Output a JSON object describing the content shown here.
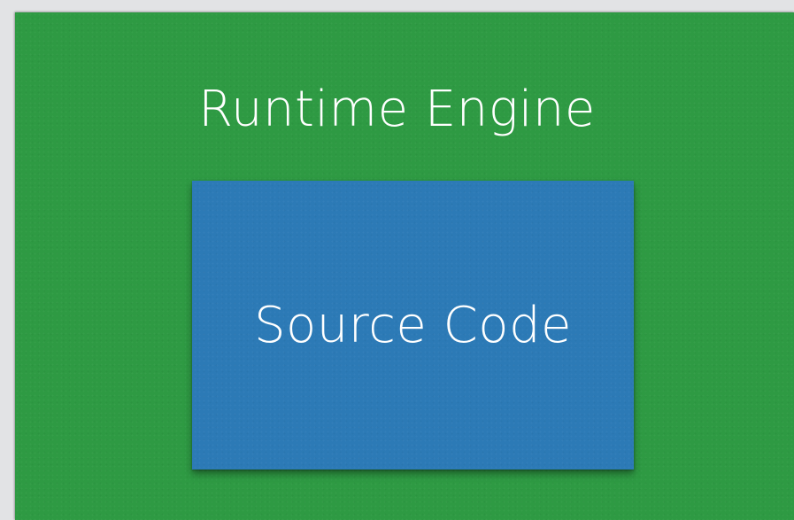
{
  "diagram": {
    "outer_block": {
      "label": "Runtime Engine",
      "color": "#2e9a43"
    },
    "inner_block": {
      "label": "Source Code",
      "color": "#2c7ab6"
    },
    "background_color": "#e2e3e5",
    "text_color": "#ffffff"
  }
}
